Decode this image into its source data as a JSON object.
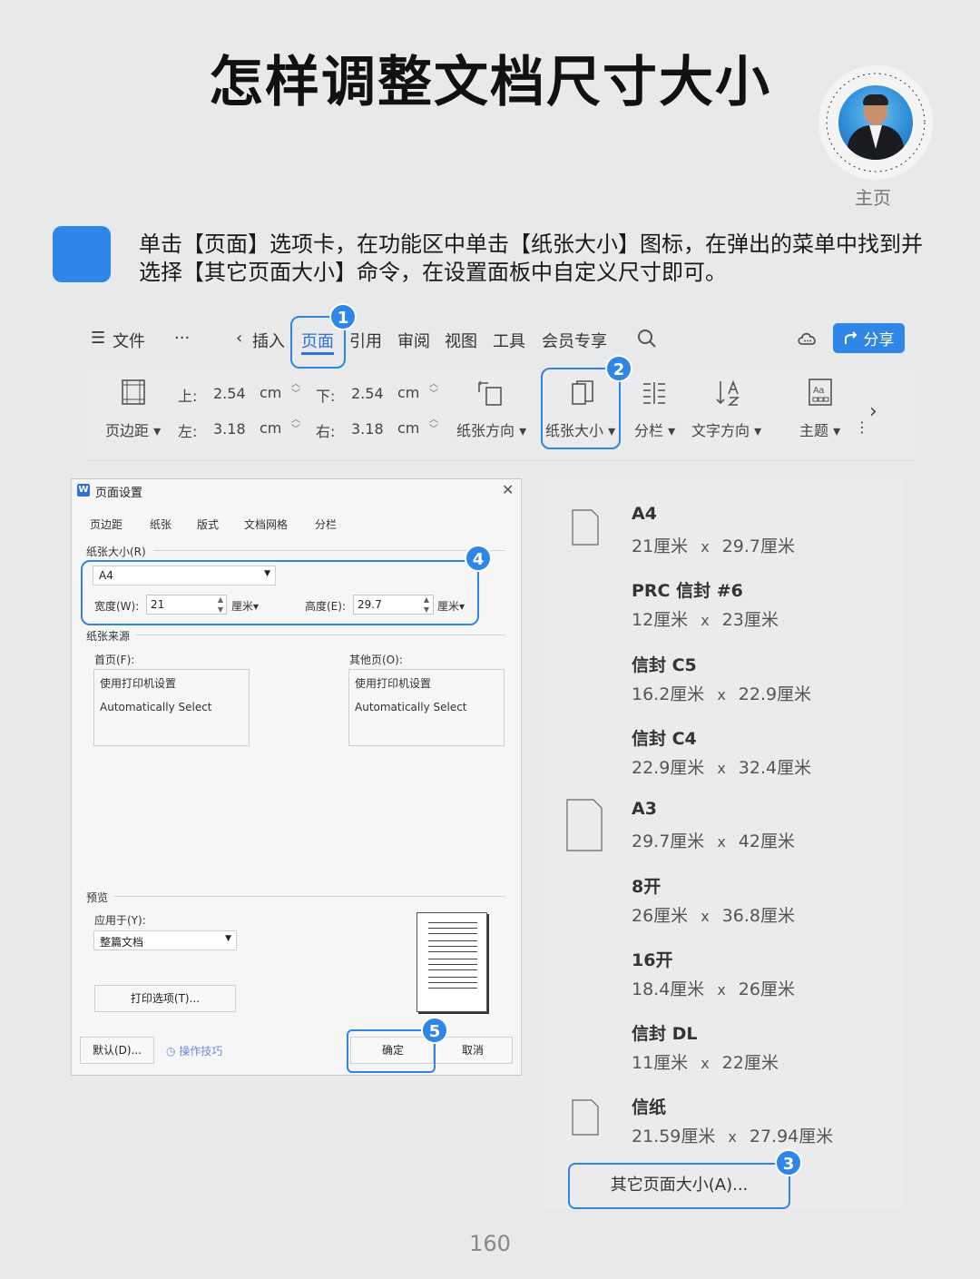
{
  "title": "怎样调整文档尺寸大小",
  "homepage_label": "主页",
  "instruction": "单击【页面】选项卡，在功能区中单击【纸张大小】图标，在弹出的菜单中找到并选择【其它页面大小】命令，在设置面板中自定义尺寸即可。",
  "ribbon": {
    "menu_label": "文件",
    "more": "···",
    "tabs": [
      "插入",
      "页面",
      "引用",
      "审阅",
      "视图",
      "工具",
      "会员专享"
    ],
    "active_tab": "页面",
    "share_label": "分享",
    "margins": {
      "label": "页边距",
      "top_label": "上:",
      "top_value": "2.54",
      "bottom_label": "下:",
      "bottom_value": "2.54",
      "left_label": "左:",
      "left_value": "3.18",
      "right_label": "右:",
      "right_value": "3.18",
      "unit": "cm"
    },
    "tools": [
      "纸张方向",
      "纸张大小",
      "分栏",
      "文字方向",
      "主题"
    ]
  },
  "badges": [
    "1",
    "2",
    "3",
    "4",
    "5"
  ],
  "dialog": {
    "title": "页面设置",
    "logo": "W",
    "tabs": [
      "页边距",
      "纸张",
      "版式",
      "文档网格",
      "分栏"
    ],
    "paper_size_label": "纸张大小(R)",
    "paper_size_value": "A4",
    "width_label": "宽度(W):",
    "width_value": "21",
    "height_label": "高度(E):",
    "height_value": "29.7",
    "unit": "厘米",
    "paper_source_label": "纸张来源",
    "first_page_label": "首页(F):",
    "other_pages_label": "其他页(O):",
    "source_options": [
      "使用打印机设置",
      "Automatically Select"
    ],
    "preview_label": "预览",
    "apply_to_label": "应用于(Y):",
    "apply_to_value": "整篇文档",
    "print_options": "打印选项(T)...",
    "default_btn": "默认(D)...",
    "tips": "操作技巧",
    "ok": "确定",
    "cancel": "取消"
  },
  "paper_sizes": [
    {
      "name": "A4",
      "w": "21厘米",
      "h": "29.7厘米"
    },
    {
      "name": "PRC 信封 #6",
      "w": "12厘米",
      "h": "23厘米"
    },
    {
      "name": "信封 C5",
      "w": "16.2厘米",
      "h": "22.9厘米"
    },
    {
      "name": "信封 C4",
      "w": "22.9厘米",
      "h": "32.4厘米"
    },
    {
      "name": "A3",
      "w": "29.7厘米",
      "h": "42厘米"
    },
    {
      "name": "8开",
      "w": "26厘米",
      "h": "36.8厘米"
    },
    {
      "name": "16开",
      "w": "18.4厘米",
      "h": "26厘米"
    },
    {
      "name": "信封 DL",
      "w": "11厘米",
      "h": "22厘米"
    },
    {
      "name": "信纸",
      "w": "21.59厘米",
      "h": "27.94厘米"
    }
  ],
  "dim_sep": "x",
  "other_sizes_label": "其它页面大小(A)...",
  "page_number": "160",
  "colors": {
    "accent": "#2f86e6",
    "active_tab": "#2f6fde",
    "background": "#e8e9eb"
  }
}
